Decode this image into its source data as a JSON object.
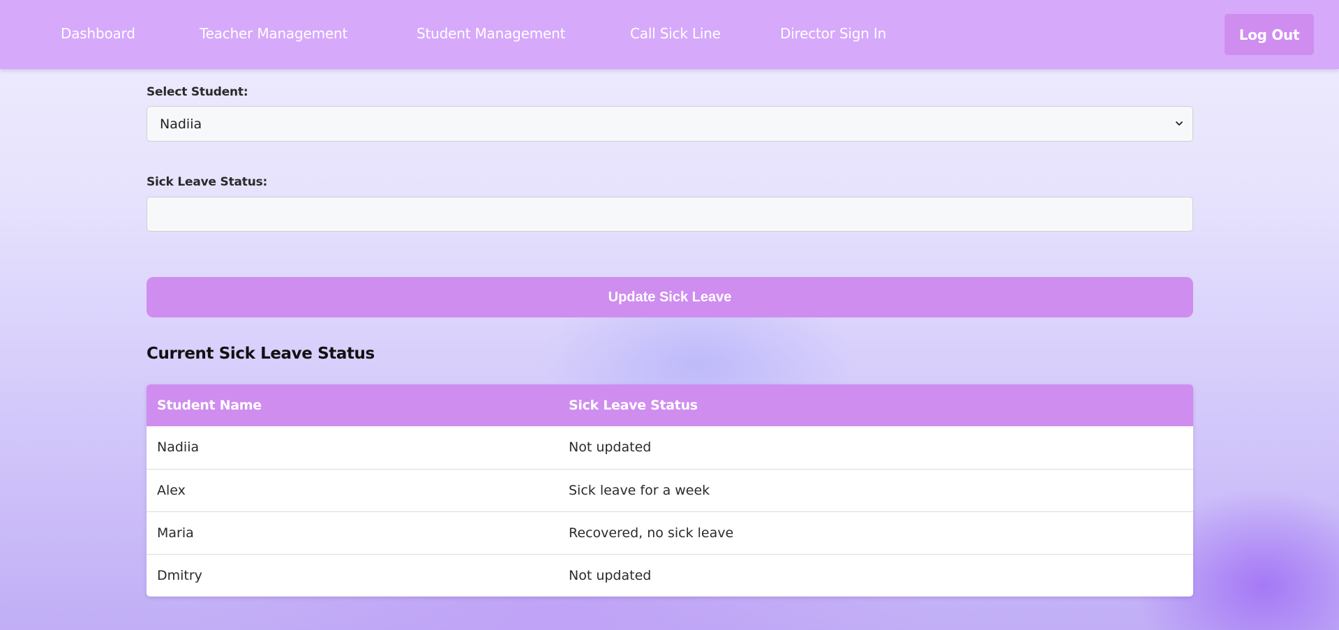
{
  "nav": {
    "items": [
      {
        "label": "Dashboard"
      },
      {
        "label": "Teacher Management"
      },
      {
        "label": "Student Management"
      },
      {
        "label": "Call Sick Line"
      },
      {
        "label": "Director Sign In"
      }
    ],
    "logout_label": "Log Out"
  },
  "form": {
    "student_label": "Select Student:",
    "student_selected": "Nadiia",
    "status_label": "Sick Leave Status:",
    "status_value": "",
    "submit_label": "Update Sick Leave"
  },
  "status_section": {
    "title": "Current Sick Leave Status",
    "columns": [
      "Student Name",
      "Sick Leave Status"
    ],
    "rows": [
      {
        "name": "Nadiia",
        "status": "Not updated"
      },
      {
        "name": "Alex",
        "status": "Sick leave for a week"
      },
      {
        "name": "Maria",
        "status": "Recovered, no sick leave"
      },
      {
        "name": "Dmitry",
        "status": "Not updated"
      }
    ]
  },
  "colors": {
    "navbar": "#d6a9fb",
    "accent": "#cf8def",
    "logout": "#cf8df0"
  },
  "icons": {
    "select_arrow": "chevron-down-icon"
  }
}
